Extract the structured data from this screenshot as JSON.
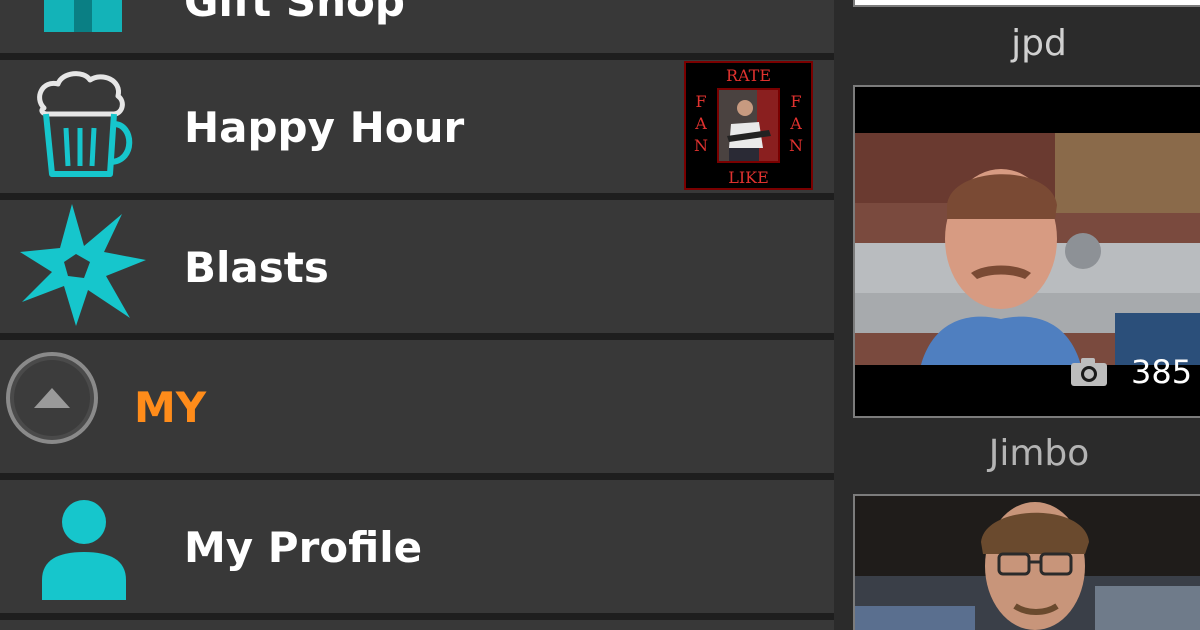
{
  "menu": {
    "items": [
      {
        "label": "Gift Shop",
        "icon": "gift-icon"
      },
      {
        "label": "Happy Hour",
        "icon": "beer-mug-icon"
      },
      {
        "label": "Blasts",
        "icon": "blast-icon"
      },
      {
        "label": "My Profile",
        "icon": "person-icon"
      }
    ],
    "section": {
      "label": "MY",
      "icon": "collapse-up-icon"
    }
  },
  "badge": {
    "top": "RATE",
    "bottom": "LIKE",
    "left": "FAN",
    "right": "FAN"
  },
  "users": [
    {
      "name": "jpd",
      "photo_count": "385"
    },
    {
      "name": "Jimbo"
    }
  ],
  "colors": {
    "accent": "#16c6cc",
    "section": "#ff8c1a",
    "row_bg": "#383838",
    "badge_red": "#e0322f"
  }
}
